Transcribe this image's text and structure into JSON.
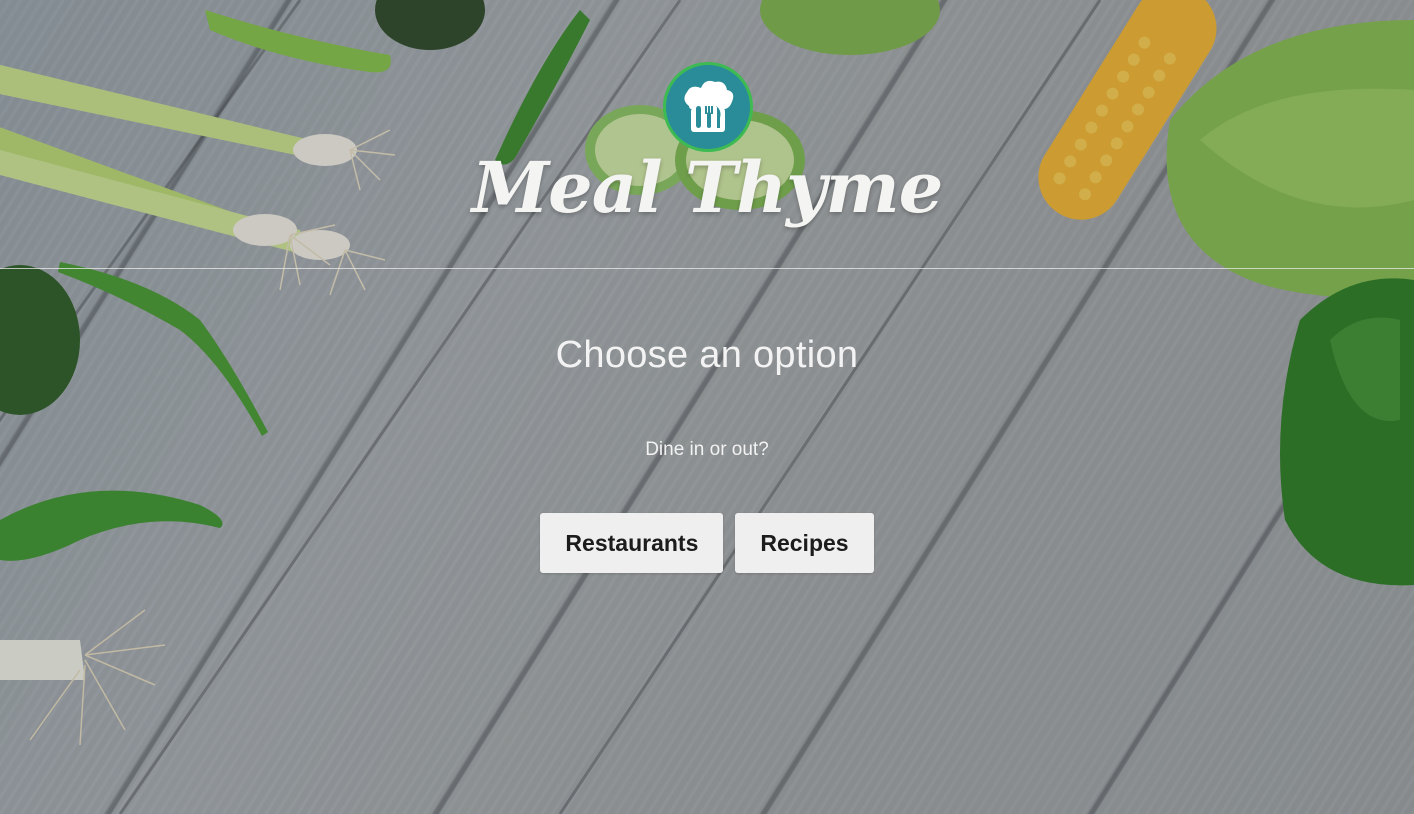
{
  "brand": {
    "name": "Meal Thyme",
    "logo_icon": "chef-hat-utensils-icon",
    "logo_bg_color": "#2b8c99",
    "logo_ring_color": "#3dbb52"
  },
  "main": {
    "heading": "Choose an option",
    "subheading": "Dine in or out?",
    "buttons": [
      {
        "label": "Restaurants"
      },
      {
        "label": "Recipes"
      }
    ]
  }
}
